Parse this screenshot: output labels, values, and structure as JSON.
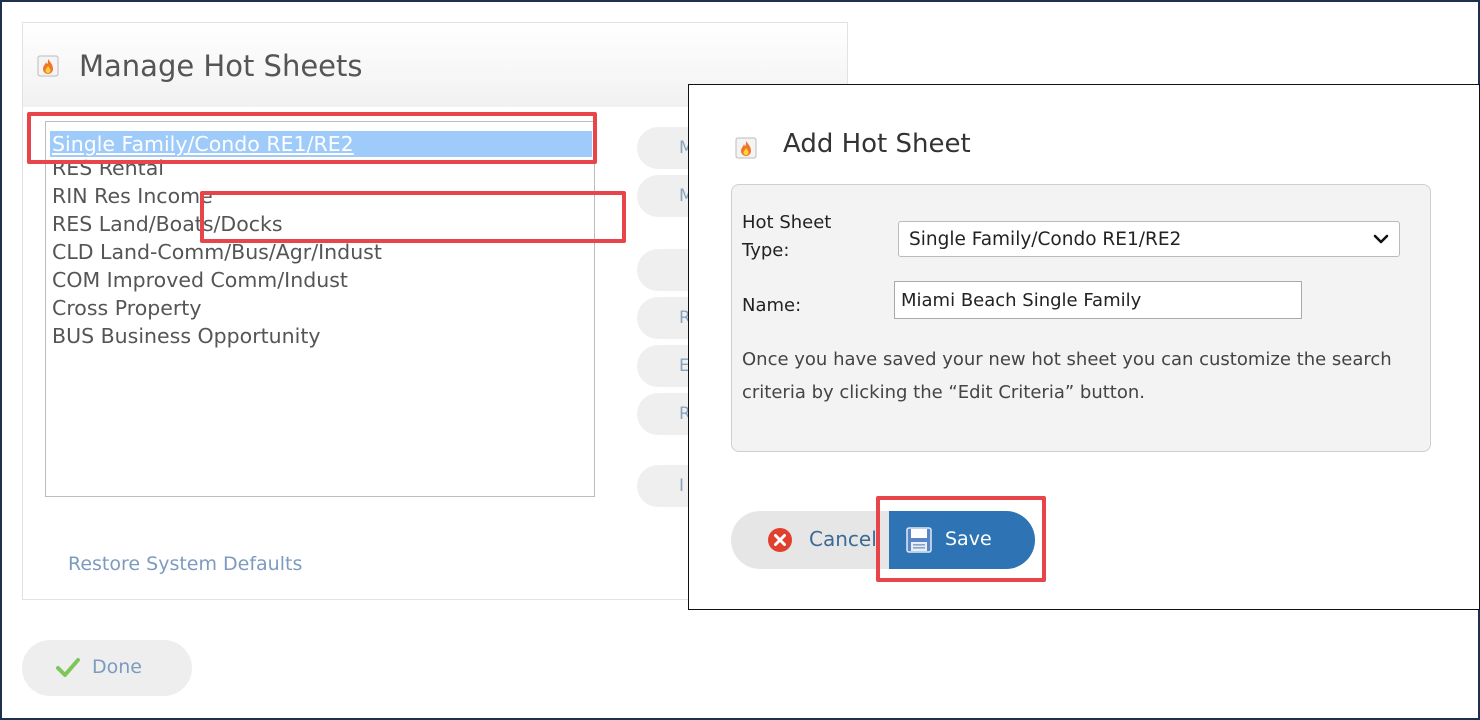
{
  "manage": {
    "title": "Manage Hot Sheets",
    "list_items": [
      "Single Family/Condo RE1/RE2",
      "RES Rental",
      "RIN Res Income",
      "RES Land/Boats/Docks",
      "CLD Land-Comm/Bus/Agr/Indust",
      "COM Improved Comm/Indust",
      "Cross Property",
      "BUS Business Opportunity"
    ],
    "selected_index": 0,
    "side_buttons": [
      "M",
      "Mo",
      "",
      "R",
      "Edi",
      "Rese",
      "I"
    ],
    "restore_link": "Restore System Defaults",
    "done_label": "Done"
  },
  "dialog": {
    "title": "Add Hot Sheet",
    "type_label": "Hot Sheet Type:",
    "type_value": "Single Family/Condo RE1/RE2",
    "name_label": "Name:",
    "name_value": "Miami Beach Single Family",
    "help_text": "Once you have saved your new hot sheet you can customize the search criteria by clicking the “Edit Criteria” button.",
    "cancel_label": "Cancel",
    "save_label": "Save"
  },
  "colors": {
    "highlight": "#e8454a",
    "save_button": "#2e73b4",
    "selection": "#9ecbfa",
    "link": "#7d9bbf"
  },
  "icons": {
    "fire": "fire-icon",
    "checkmark": "checkmark-icon",
    "cancel": "cancel-x-icon",
    "save": "floppy-disk-icon",
    "chevron": "chevron-down-icon"
  }
}
